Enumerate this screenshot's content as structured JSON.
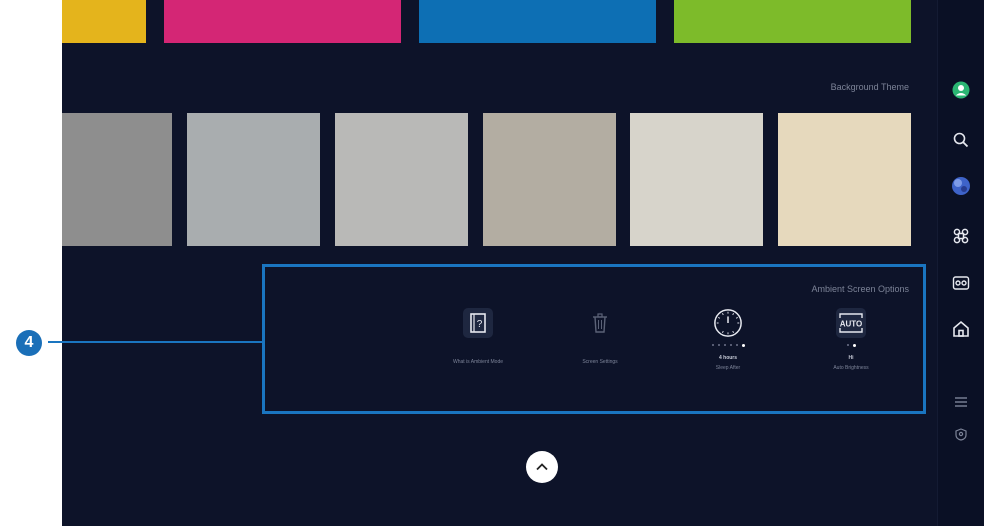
{
  "colors": {
    "screen_bg": "#0d1329",
    "accent": "#1a75c0",
    "swatch_1": "#e4b41c",
    "swatch_2": "#d42675",
    "swatch_3": "#0d6fb4",
    "swatch_4": "#7dbb2a",
    "tile_1": "#8e8e8e",
    "tile_2": "#a9adaf",
    "tile_3": "#b9b9b7",
    "tile_4": "#b3ada2",
    "tile_5": "#d7d4cb",
    "tile_6": "#e6d9bd"
  },
  "background_theme": {
    "title": "Background Theme"
  },
  "ambient_options": {
    "title": "Ambient Screen Options",
    "items": [
      {
        "icon": "help-icon",
        "label": "What is Ambient Mode",
        "value": ""
      },
      {
        "icon": "trash-icon",
        "label": "Screen Settings",
        "value": ""
      },
      {
        "icon": "clock-icon",
        "label": "Sleep After",
        "value": "4 hours"
      },
      {
        "icon": "auto-icon",
        "label": "Auto Brightness",
        "value": "Hi"
      }
    ]
  },
  "callout": {
    "number": "4"
  },
  "sidebar": {
    "items": [
      "profile-icon",
      "search-icon",
      "globe-icon",
      "ambient-icon",
      "game-icon",
      "home-icon",
      "menu-icon",
      "shield-icon"
    ]
  },
  "scroll_up_icon": "chevron-up-icon"
}
